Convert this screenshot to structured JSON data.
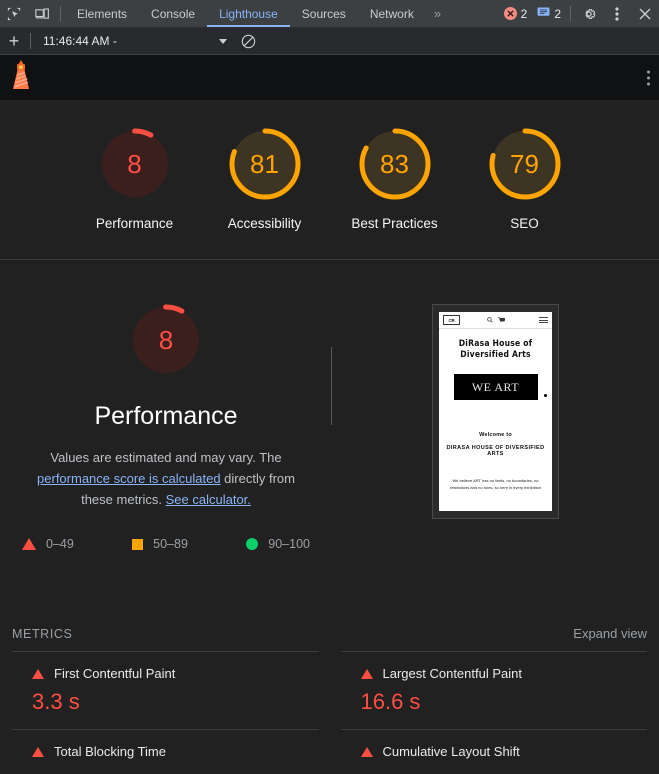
{
  "devtools": {
    "icons": {
      "inspect": "inspect-element-icon",
      "device": "device-toolbar-icon"
    },
    "tabs": [
      {
        "label": "Elements",
        "active": false
      },
      {
        "label": "Console",
        "active": false
      },
      {
        "label": "Lighthouse",
        "active": true
      },
      {
        "label": "Sources",
        "active": false
      },
      {
        "label": "Network",
        "active": false
      }
    ],
    "more_tabs": "»",
    "badges": {
      "errors": "2",
      "messages": "2"
    },
    "settings_icon": "gear-icon",
    "menu_icon": "kebab-menu-icon",
    "close_icon": "close-icon"
  },
  "lighthouse_toolbar": {
    "add_label": "+",
    "run_selected": "11:46:44 AM -",
    "clear_icon": "clear-icon",
    "logo": "lighthouse-logo",
    "panel_menu": "kebab-menu-icon"
  },
  "scores": [
    {
      "label": "Performance",
      "value": 8,
      "color": "#ff4e42",
      "track": "#3b1f1d"
    },
    {
      "label": "Accessibility",
      "value": 81,
      "color": "#ffa400",
      "track": "#3e3423"
    },
    {
      "label": "Best Practices",
      "value": 83,
      "color": "#ffa400",
      "track": "#3e3423"
    },
    {
      "label": "SEO",
      "value": 79,
      "color": "#ffa400",
      "track": "#3e3423"
    }
  ],
  "performance": {
    "score": 8,
    "title": "Performance",
    "desc_part1": "Values are estimated and may vary. The ",
    "link1": "performance score is calculated",
    "desc_part2": " directly from these metrics. ",
    "link2": "See calculator.",
    "legend": [
      {
        "icon": "triangle-red",
        "range": "0–49",
        "color": "#ff4e42"
      },
      {
        "icon": "square-orange",
        "range": "50–89",
        "color": "#ffa400"
      },
      {
        "icon": "circle-green",
        "range": "90–100",
        "color": "#0cce6b"
      }
    ]
  },
  "screenshot_preview": {
    "logo_text": "CR",
    "search_icon": "search-icon",
    "cart_icon": "cart-icon",
    "menu_icon": "hamburger-icon",
    "site_title": "DiRasa House of Diversified Arts",
    "hero_text": "WE ART",
    "welcome": "Welcome to",
    "subtitle": "DIRASA HOUSE OF DIVERSIFIED ARTS",
    "body": "We believe ART has no limits, no boundaries, no restrictions and no rules, so here in every exhibition"
  },
  "metrics_section": {
    "title": "METRICS",
    "expand_label": "Expand view",
    "items": [
      {
        "name": "First Contentful Paint",
        "value": "3.3 s",
        "rating": "fail"
      },
      {
        "name": "Largest Contentful Paint",
        "value": "16.6 s",
        "rating": "fail"
      },
      {
        "name": "Total Blocking Time",
        "value": "",
        "rating": "fail"
      },
      {
        "name": "Cumulative Layout Shift",
        "value": "",
        "rating": "fail"
      }
    ]
  }
}
